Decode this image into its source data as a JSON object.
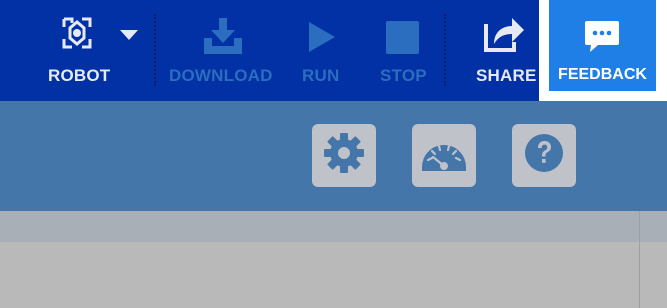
{
  "toolbar": {
    "robot_label": "ROBOT",
    "download_label": "DOWNLOAD",
    "run_label": "RUN",
    "stop_label": "STOP",
    "share_label": "SHARE",
    "feedback_label": "FEEDBACK"
  },
  "icons": {
    "robot": "robot-icon",
    "dropdown": "caret-down-icon",
    "download": "download-icon",
    "run": "play-icon",
    "stop": "stop-icon",
    "share": "share-icon",
    "feedback": "chat-bubble-icon",
    "settings": "gear-icon",
    "dashboard": "gauge-icon",
    "help": "question-icon"
  },
  "colors": {
    "toolbar_bg": "#0131a5",
    "feedback_bg": "#1f7fe6",
    "subbar_bg": "#4476a9",
    "disabled_text": "#2b6dbe",
    "enabled_text": "#e7eaf5"
  }
}
